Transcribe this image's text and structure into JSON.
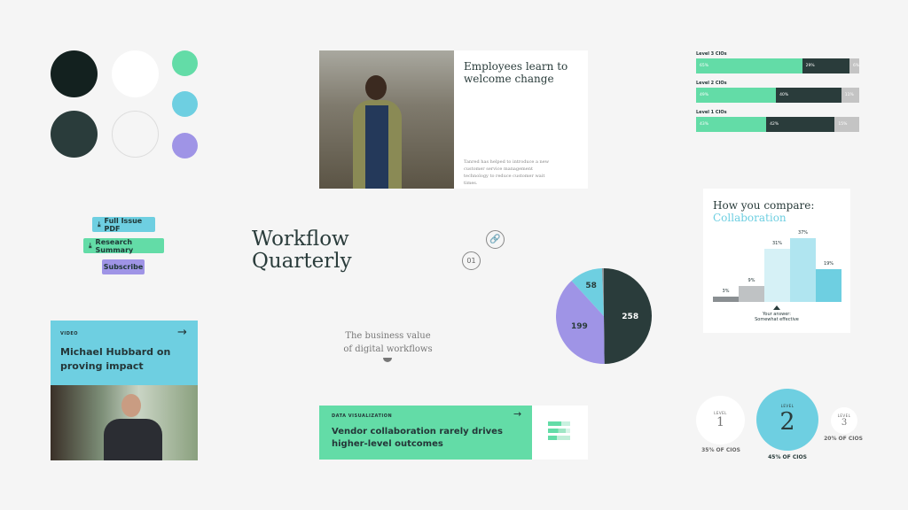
{
  "palette": {
    "colors": [
      "#13211f",
      "#ffffff",
      "#63dca7",
      "#2a3c3b",
      "#f5f5f5",
      "#6ecfe1",
      "#9f94e6"
    ]
  },
  "article_card": {
    "title": "Employees learn to welcome change",
    "body": "Tanred has helped to introduce a new customer service management technology to reduce customer wait times."
  },
  "buttons": {
    "pdf": "Full Issue PDF",
    "research": "Research Summary",
    "subscribe": "Subscribe",
    "download_icon": "download-icon"
  },
  "brand": {
    "line1": "Workflow",
    "line2": "Quarterly"
  },
  "link_icon": "link-icon",
  "page_number": "01",
  "tagline": {
    "line1": "The business value",
    "line2": "of digital workflows"
  },
  "video_card": {
    "kicker": "VIDEO",
    "title": "Michael Hubbard on proving impact"
  },
  "dataviz_card": {
    "kicker": "DATA VISUALIZATION",
    "title": "Vendor collaboration rarely drives higher-level outcomes"
  },
  "chart_data": [
    {
      "type": "bar",
      "orientation": "horizontal-stacked",
      "colors": [
        "#63dca7",
        "#2a3c3b",
        "#c4c4c4"
      ],
      "categories": [
        "Level 3 CIOs",
        "Level 2 CIOs",
        "Level 1 CIOs"
      ],
      "values": [
        [
          65,
          29,
          6
        ],
        [
          49,
          40,
          11
        ],
        [
          43,
          42,
          15
        ]
      ],
      "labels": [
        [
          "65%",
          "29%",
          "6%"
        ],
        [
          "49%",
          "40%",
          "11%"
        ],
        [
          "43%",
          "42%",
          "15%"
        ]
      ]
    },
    {
      "type": "bar",
      "title": "How you compare:",
      "subtitle": "Collaboration",
      "values": [
        3,
        9,
        31,
        37,
        19
      ],
      "labels": [
        "3%",
        "9%",
        "31%",
        "37%",
        "19%"
      ],
      "colors": [
        "#8a8f92",
        "#bfc2c4",
        "#d6f1f6",
        "#b0e5f0",
        "#6ecfe1"
      ],
      "annotation": {
        "line1": "Your answer:",
        "line2": "Somewhat effective"
      }
    },
    {
      "type": "pie",
      "values": [
        258,
        199,
        58,
        3
      ],
      "labels": [
        "258",
        "199",
        "58",
        ""
      ],
      "colors": [
        "#2a3c3b",
        "#9f94e6",
        "#6ecfe1",
        "#8a8f92"
      ]
    }
  ],
  "levels": [
    {
      "label": "LEVEL",
      "num": "1",
      "caption": "35% OF CIOS"
    },
    {
      "label": "LEVEL",
      "num": "2",
      "caption": "45% OF CIOS"
    },
    {
      "label": "LEVEL",
      "num": "3",
      "caption": "20% OF CIOS"
    }
  ]
}
